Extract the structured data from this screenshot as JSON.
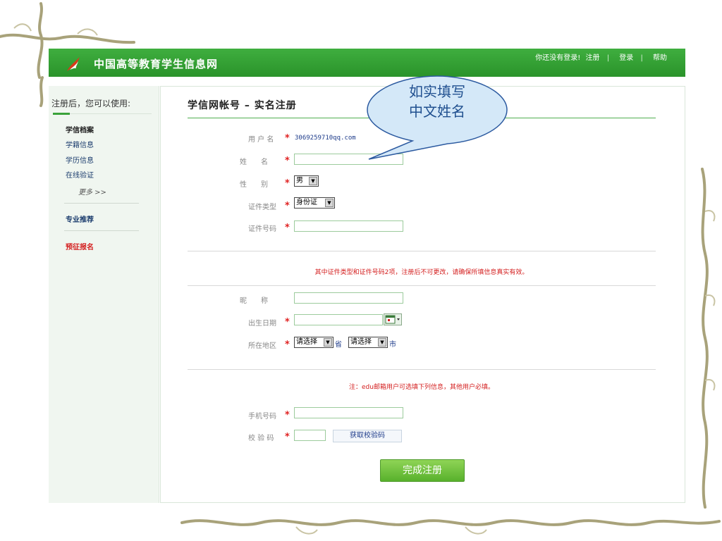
{
  "header": {
    "site_title": "中国高等教育学生信息网",
    "status_text": "你还没有登录!",
    "register_link": "注册",
    "login_link": "登录",
    "help_link": "帮助",
    "separator": "|"
  },
  "sidebar": {
    "heading": "注册后，您可以使用:",
    "items": [
      "学信档案",
      "学籍信息",
      "学历信息",
      "在线验证"
    ],
    "more": "更多 >>",
    "recommend": "专业推荐",
    "preregister": "预征报名"
  },
  "main": {
    "title": "学信网帐号 – 实名注册",
    "username_label": "用 户 名",
    "username_value": "3069259710qq.com",
    "name_label": "姓　　名",
    "gender_label": "性　　别",
    "gender_value": "男",
    "id_type_label": "证件类型",
    "id_type_value": "身份证",
    "id_number_label": "证件号码",
    "id_note": "其中证件类型和证件号码2项，注册后不可更改，请确保所填信息真实有效。",
    "nickname_label": "昵　　称",
    "birthdate_label": "出生日期",
    "region_label": "所在地区",
    "province_select": "请选择",
    "province_suffix": "省",
    "city_select": "请选择",
    "city_suffix": "市",
    "edu_note": "注：edu邮箱用户可选填下列信息，其他用户必填。",
    "phone_label": "手机号码",
    "code_label": "校 验 码",
    "get_code_button": "获取校验码",
    "submit_button": "完成注册",
    "required_mark": "*"
  },
  "callout": {
    "line1": "如实填写",
    "line2": "中文姓名"
  },
  "colors": {
    "header_green": "#2f9e2f",
    "sidebar_bg": "#f0f6f0",
    "required_red": "#e02222",
    "bubble_fill": "#d4e8f8",
    "bubble_text": "#1f4f8f",
    "submit_green": "#6cbf3a"
  }
}
